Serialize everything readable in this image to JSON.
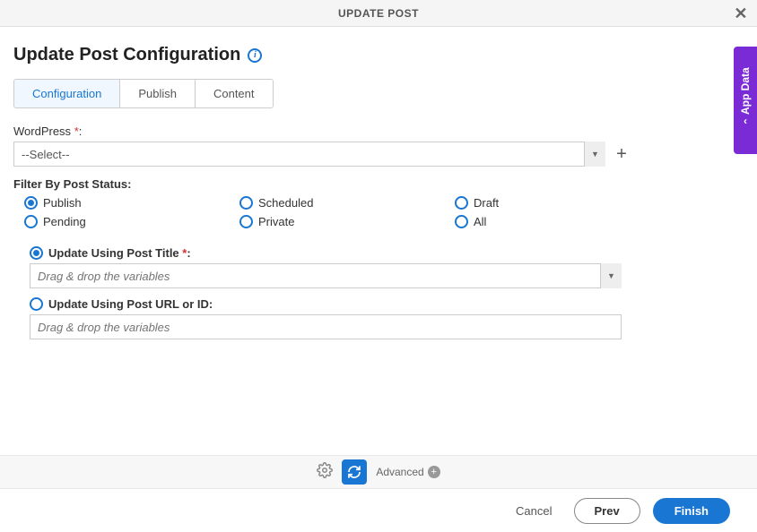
{
  "header": {
    "title": "UPDATE POST"
  },
  "page": {
    "title": "Update Post Configuration"
  },
  "tabs": [
    {
      "label": "Configuration",
      "active": true
    },
    {
      "label": "Publish",
      "active": false
    },
    {
      "label": "Content",
      "active": false
    }
  ],
  "wordpress": {
    "label": "WordPress",
    "required_mark": "*",
    "colon": ":",
    "value": "--Select--"
  },
  "filter": {
    "label": "Filter By Post Status:",
    "options": [
      {
        "label": "Publish",
        "checked": true
      },
      {
        "label": "Scheduled",
        "checked": false
      },
      {
        "label": "Draft",
        "checked": false
      },
      {
        "label": "Pending",
        "checked": false
      },
      {
        "label": "Private",
        "checked": false
      },
      {
        "label": "All",
        "checked": false
      }
    ]
  },
  "update_options": [
    {
      "label": "Update Using Post Title",
      "required": true,
      "checked": true,
      "placeholder": "Drag & drop the variables",
      "has_dropdown": true
    },
    {
      "label": "Update Using Post URL or ID:",
      "required": false,
      "checked": false,
      "placeholder": "Drag & drop the variables",
      "has_dropdown": false
    }
  ],
  "bottom": {
    "advanced": "Advanced"
  },
  "footer": {
    "cancel": "Cancel",
    "prev": "Prev",
    "finish": "Finish"
  },
  "side_panel": {
    "label": "App Data"
  },
  "colors": {
    "primary": "#1976d2",
    "accent": "#7b2bd6"
  }
}
